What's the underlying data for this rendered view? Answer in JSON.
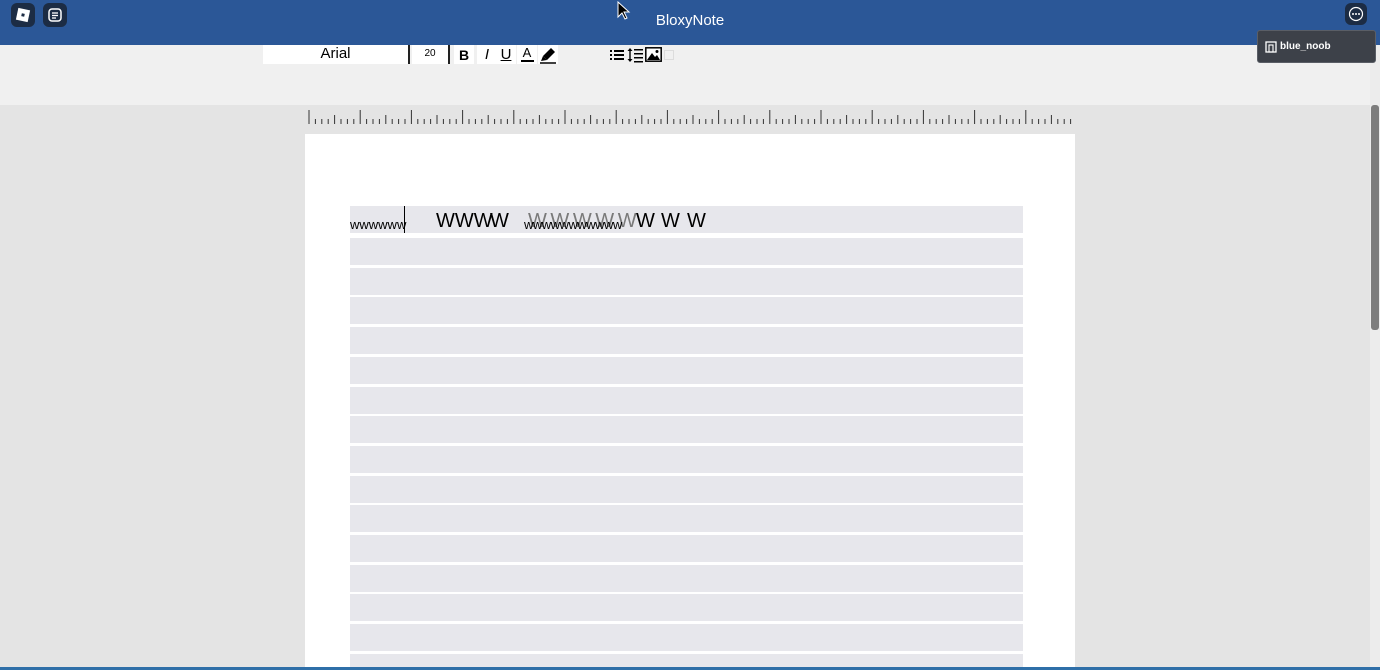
{
  "window": {
    "title": "BloxyNote",
    "user": "blue_noob"
  },
  "toolbar": {
    "font_name": "Arial",
    "font_size": "20",
    "bold_label": "B",
    "italic_label": "I",
    "underline_label": "U",
    "font_color_label": "A",
    "tools": [
      "bold-icon",
      "italic-icon",
      "underline-icon",
      "font-color-icon",
      "highlighter-icon",
      "bullet-list-icon",
      "line-spacing-icon",
      "image-icon"
    ]
  },
  "document": {
    "line1_segments": [
      "wwwwww",
      "WWW",
      "W",
      "W W W W W",
      "wwwwwwwwwww",
      "W",
      "W",
      "W"
    ]
  },
  "colors": {
    "titlebar": "#2b5797",
    "toolbar": "#f0f0f0",
    "line_background": "#e7e7ec"
  }
}
